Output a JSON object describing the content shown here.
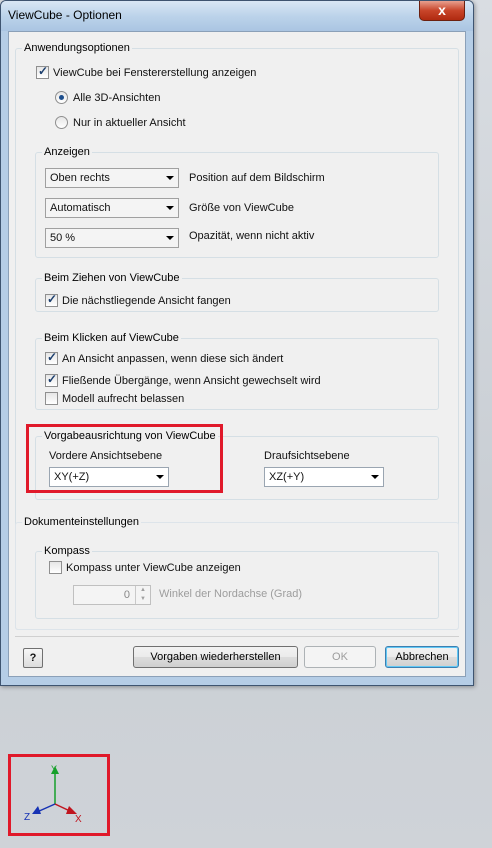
{
  "window": {
    "title": "ViewCube - Optionen",
    "close_label": "x"
  },
  "app_options": {
    "legend": "Anwendungsoptionen",
    "show_on_create": {
      "label": "ViewCube bei Fenstererstellung anzeigen",
      "checked": true
    },
    "radio_all": {
      "label": "Alle 3D-Ansichten",
      "checked": true
    },
    "radio_current": {
      "label": "Nur in aktueller Ansicht",
      "checked": false
    }
  },
  "display": {
    "legend": "Anzeigen",
    "position": {
      "value": "Oben rechts",
      "label": "Position auf dem Bildschirm"
    },
    "size": {
      "value": "Automatisch",
      "label": "Größe von ViewCube"
    },
    "opacity": {
      "value": "50 %",
      "label": "Opazität, wenn nicht aktiv"
    }
  },
  "drag": {
    "legend": "Beim Ziehen von ViewCube",
    "snap": {
      "label": "Die nächstliegende Ansicht fangen",
      "checked": true
    }
  },
  "click": {
    "legend": "Beim Klicken auf ViewCube",
    "fit": {
      "label": "An Ansicht anpassen, wenn diese sich ändert",
      "checked": true
    },
    "smooth": {
      "label": "Fließende Übergänge, wenn Ansicht gewechselt wird",
      "checked": true
    },
    "upright": {
      "label": "Modell aufrecht belassen",
      "checked": false
    }
  },
  "default_orientation": {
    "legend": "Vorgabeausrichtung von ViewCube",
    "front_label": "Vordere Ansichtsebene",
    "front_value": "XY(+Z)",
    "top_label": "Draufsichtsebene",
    "top_value": "XZ(+Y)"
  },
  "document": {
    "legend": "Dokumenteinstellungen",
    "compass_legend": "Kompass",
    "show_compass": {
      "label": "Kompass unter ViewCube anzeigen",
      "checked": false
    },
    "north_angle_value": "0",
    "north_angle_label": "Winkel der Nordachse (Grad)"
  },
  "buttons": {
    "help": "?",
    "restore": "Vorgaben wiederherstellen",
    "ok": "OK",
    "cancel": "Abbrechen"
  },
  "axis_triad": {
    "y": "Y",
    "z": "Z",
    "x": "X"
  },
  "colors": {
    "highlight": "#e0192a",
    "axis_x": "#c0141e",
    "axis_y": "#16a02a",
    "axis_z": "#1632b4"
  }
}
